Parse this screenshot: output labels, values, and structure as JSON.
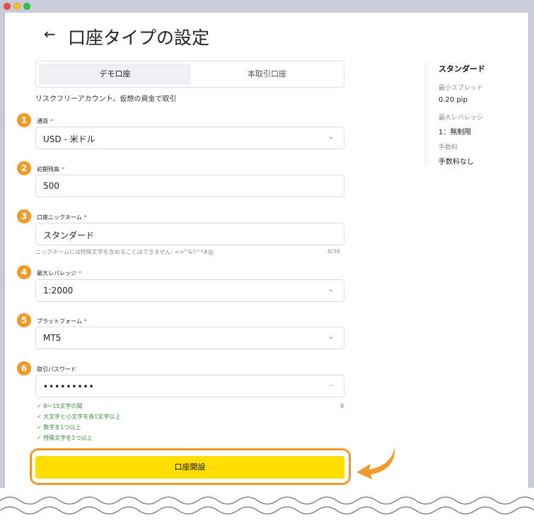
{
  "window": {
    "controls": [
      "close",
      "minimize",
      "maximize"
    ]
  },
  "header": {
    "back_icon": "←",
    "title": "口座タイプの設定"
  },
  "tabs": [
    {
      "label": "デモ口座",
      "active": true
    },
    {
      "label": "本取引口座",
      "active": false
    }
  ],
  "description": "リスクフリーアカウント。仮想の資金で取引",
  "form": {
    "currency": {
      "step": "1",
      "label": "通貨",
      "required": "*",
      "value": "USD - 米ドル"
    },
    "balance": {
      "step": "2",
      "label": "初期残高",
      "required": "*",
      "value": "500"
    },
    "nickname": {
      "step": "3",
      "label": "口座ニックネーム",
      "required": "*",
      "value": "スタンダード",
      "hint": "ニックネームには特殊文字を含めることはできません: <>\"'&?^*#@",
      "counter": "6/36"
    },
    "leverage": {
      "step": "4",
      "label": "最大レバレッジ",
      "required": "*",
      "value": "1:2000"
    },
    "platform": {
      "step": "5",
      "label": "プラットフォーム",
      "required": "*",
      "value": "MT5"
    },
    "password": {
      "step": "6",
      "label": "取引パスワード",
      "value": "•••••••••",
      "length_count": "9",
      "rules": [
        "8～15文字の間",
        "大文字と小文字を各1文字以上",
        "数字を1つ以上",
        "特殊文字を1つ以上"
      ]
    }
  },
  "submit_label": "口座開設",
  "summary": {
    "heading": "スタンダード",
    "items": [
      {
        "key": "最小スプレッド",
        "value": "0.20 pip"
      },
      {
        "key": "最大レバレッジ",
        "value": "1：無制限"
      },
      {
        "key": "手数料",
        "value": "手数料なし"
      }
    ]
  },
  "colors": {
    "accent_orange": "#f09a2a",
    "cta_yellow": "#ffde00",
    "required_red": "#e0453d",
    "valid_green": "#3a8a3e"
  }
}
